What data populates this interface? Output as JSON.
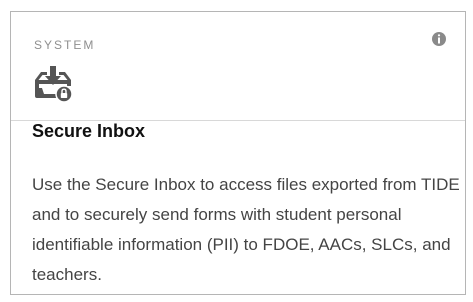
{
  "card": {
    "category": "SYSTEM",
    "title": "Secure Inbox",
    "description": "Use the Secure Inbox to access files exported from TIDE and to securely send forms with student personal identifiable information (PII) to FDOE, AACs, SLCs, and teachers.",
    "icons": {
      "app": "inbox-download-icon",
      "info": "info-icon"
    },
    "colors": {
      "border": "#b5b5b5",
      "icon": "#555555",
      "category_text": "#8f8f8f"
    }
  }
}
